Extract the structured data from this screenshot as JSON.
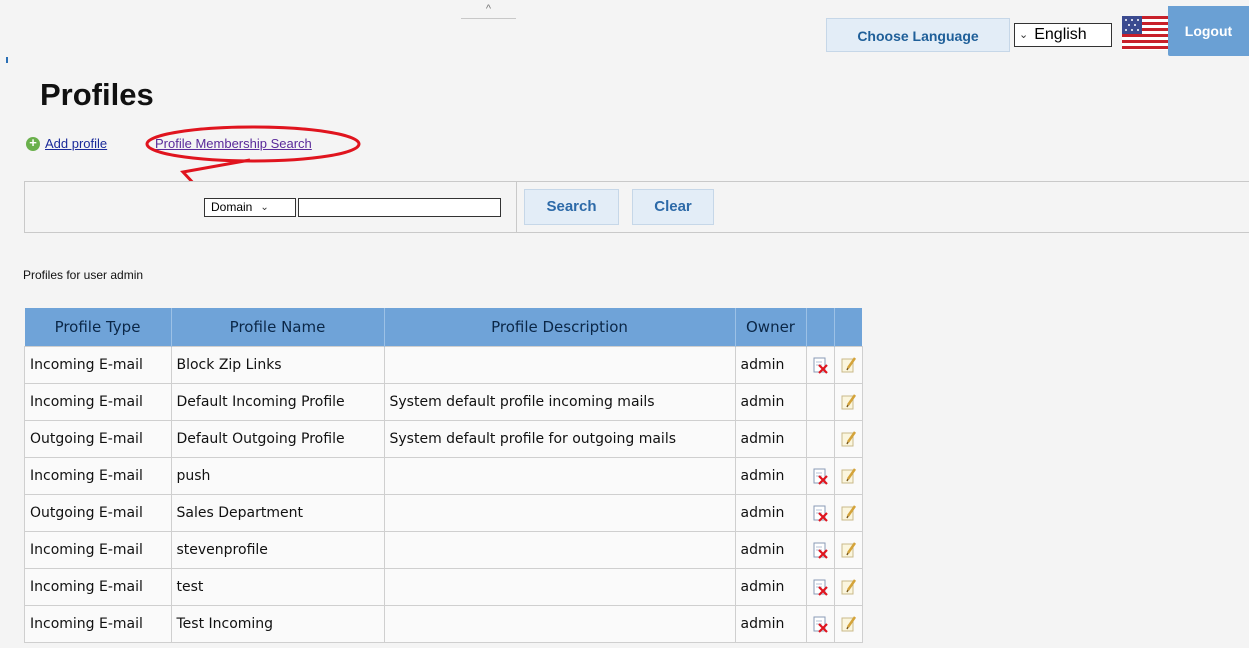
{
  "topbar": {
    "collapse_glyph": "^",
    "choose_language": "Choose Language",
    "language_value": "English",
    "logout": "Logout",
    "flag": "us-flag-icon"
  },
  "page_title": "Profiles",
  "links": {
    "add_profile": "Add profile",
    "membership_search": "Profile Membership Search"
  },
  "search": {
    "domain_option": "Domain",
    "input_value": "",
    "search_button": "Search",
    "clear_button": "Clear"
  },
  "profiles_for": "Profiles for user admin",
  "table": {
    "headers": [
      "Profile Type",
      "Profile Name",
      "Profile Description",
      "Owner"
    ],
    "rows": [
      {
        "type": "Incoming E-mail",
        "name": "Block Zip Links",
        "description": "",
        "owner": "admin",
        "delete": true
      },
      {
        "type": "Incoming E-mail",
        "name": "Default Incoming Profile",
        "description": "System default profile incoming mails",
        "owner": "admin",
        "delete": false
      },
      {
        "type": "Outgoing E-mail",
        "name": "Default Outgoing Profile",
        "description": "System default profile for outgoing mails",
        "owner": "admin",
        "delete": false
      },
      {
        "type": "Incoming E-mail",
        "name": "push",
        "description": "",
        "owner": "admin",
        "delete": true
      },
      {
        "type": "Outgoing E-mail",
        "name": "Sales Department",
        "description": "",
        "owner": "admin",
        "delete": true
      },
      {
        "type": "Incoming E-mail",
        "name": "stevenprofile",
        "description": "",
        "owner": "admin",
        "delete": true
      },
      {
        "type": "Incoming E-mail",
        "name": "test",
        "description": "",
        "owner": "admin",
        "delete": true
      },
      {
        "type": "Incoming E-mail",
        "name": "Test Incoming",
        "description": "",
        "owner": "admin",
        "delete": true
      }
    ]
  },
  "colors": {
    "header_bg": "#6fa3d8",
    "button_bg": "#e3edf7",
    "annotation_red": "#e0141e",
    "logout_bg": "#6aa0d4"
  }
}
